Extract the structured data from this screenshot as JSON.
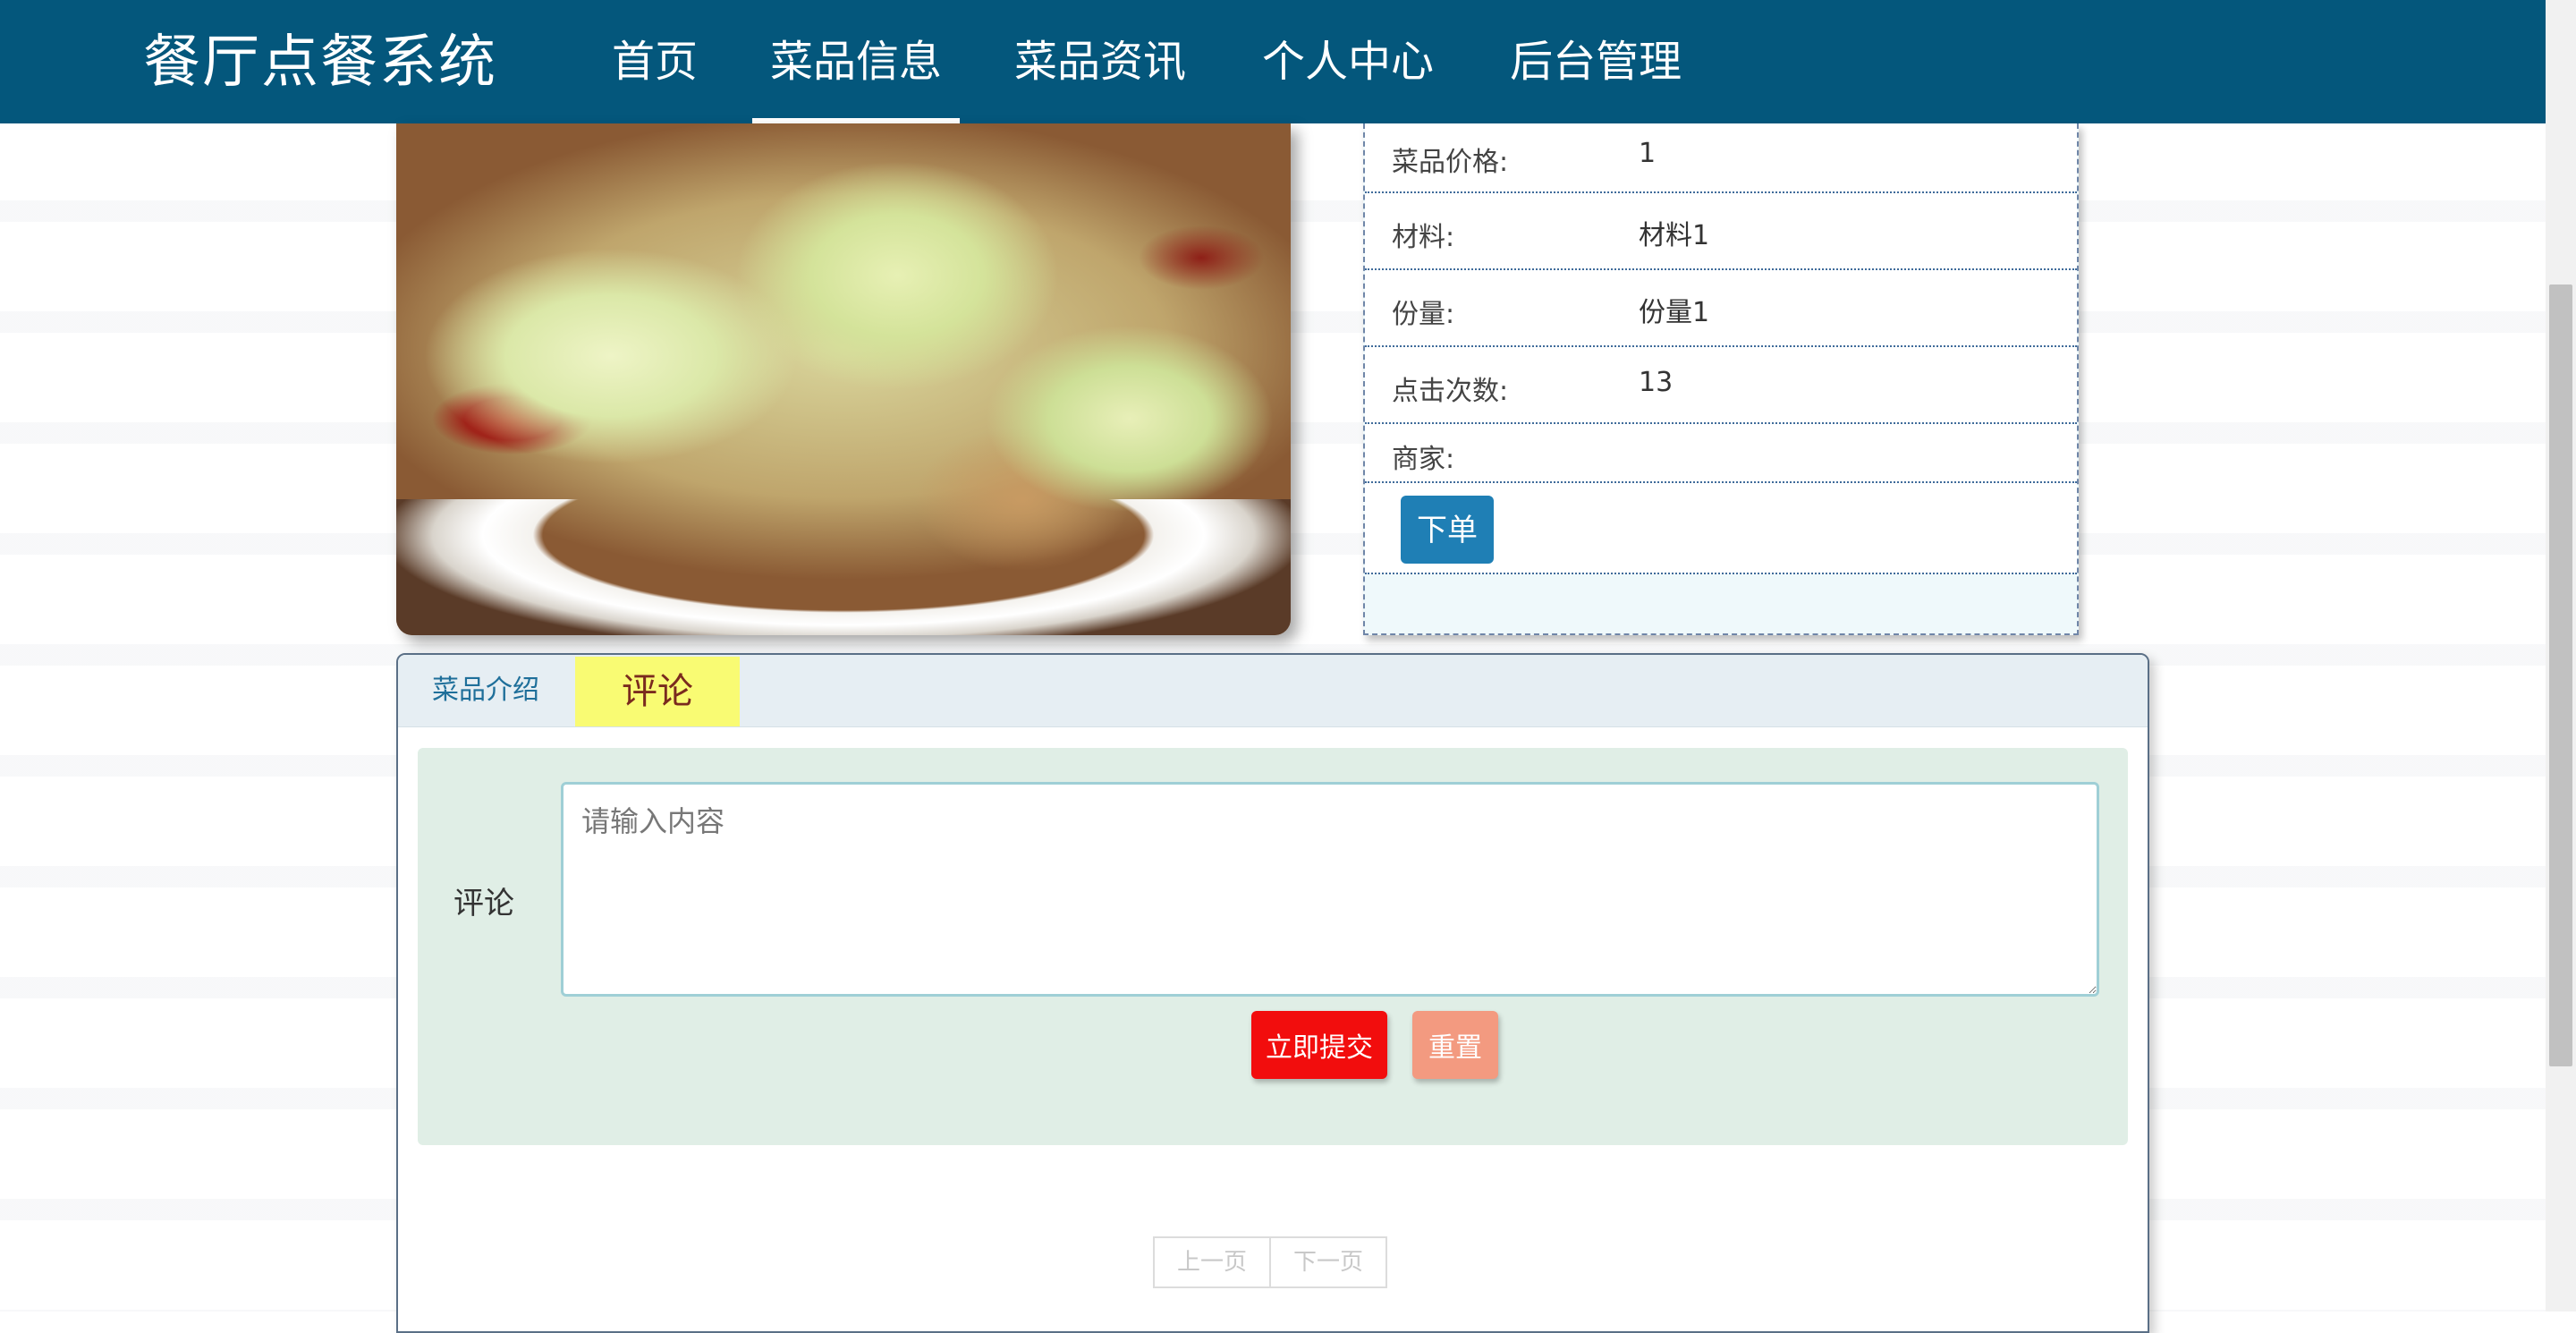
{
  "header": {
    "brand": "餐厅点餐系统",
    "nav": [
      {
        "label": "首页"
      },
      {
        "label": "菜品信息"
      },
      {
        "label": "菜品资讯"
      },
      {
        "label": "个人中心"
      },
      {
        "label": "后台管理"
      }
    ],
    "active_nav": "菜品信息",
    "background_color": "#04577c"
  },
  "dish_image": {
    "alt": "cabbage-stir-fry-photo"
  },
  "details": {
    "rows": [
      {
        "label": "菜品价格:",
        "value": "1"
      },
      {
        "label": "材料:",
        "value": "材料1"
      },
      {
        "label": "份量:",
        "value": "份量1"
      },
      {
        "label": "点击次数:",
        "value": "13"
      },
      {
        "label": "商家:",
        "value": ""
      }
    ],
    "order_button": "下单"
  },
  "tabs": {
    "items": [
      {
        "label": "菜品介绍"
      },
      {
        "label": "评论"
      }
    ],
    "active": "评论"
  },
  "comment_form": {
    "label": "评论",
    "placeholder": "请输入内容",
    "submit_label": "立即提交",
    "reset_label": "重置"
  },
  "pager": {
    "prev_label": "上一页",
    "next_label": "下一页"
  }
}
